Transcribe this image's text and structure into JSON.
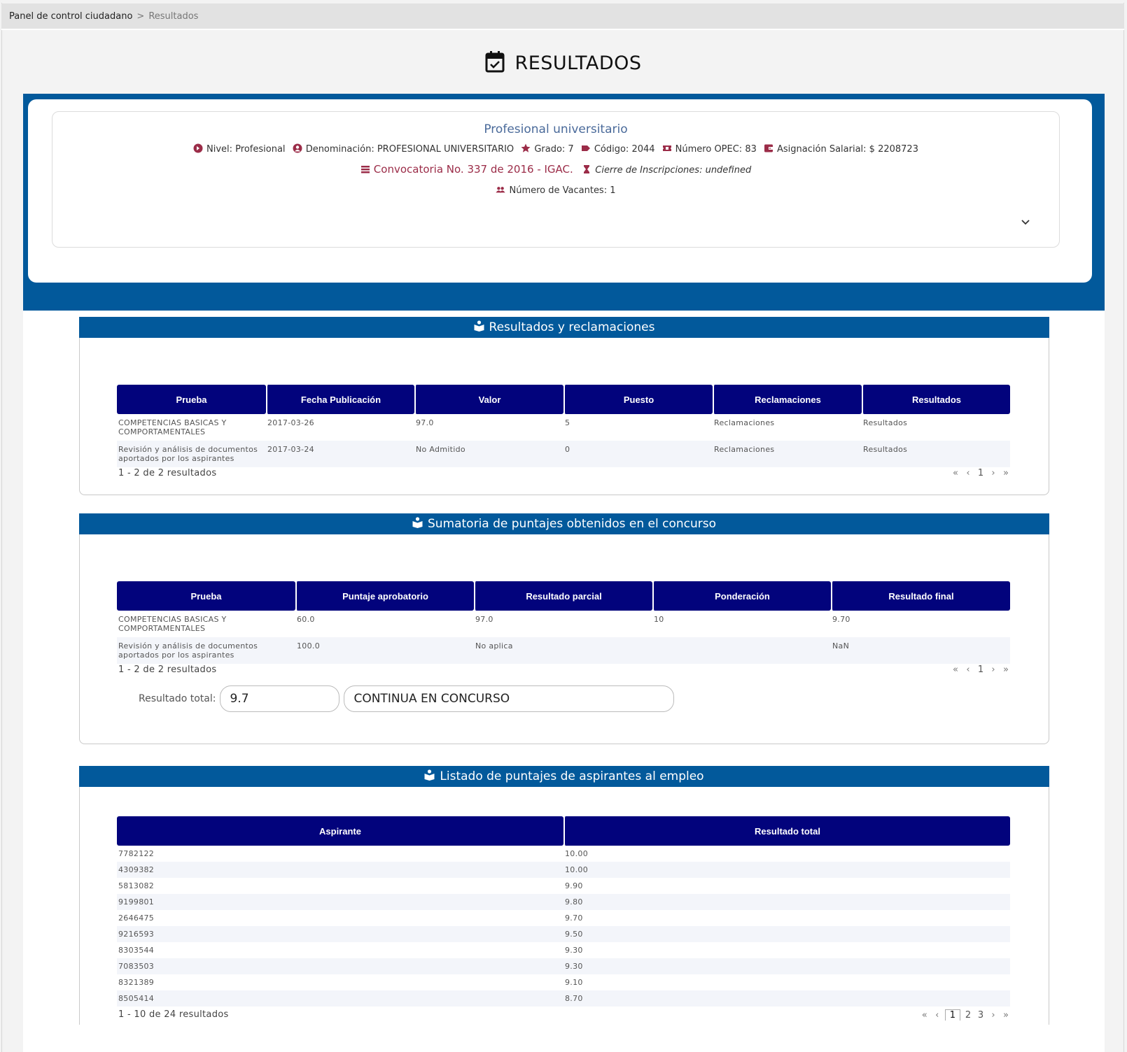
{
  "breadcrumb": {
    "root": "Panel de control ciudadano",
    "separator": ">",
    "current": "Resultados"
  },
  "page_title": "RESULTADOS",
  "job": {
    "title": "Profesional universitario",
    "nivel": "Nivel: Profesional",
    "denominacion": "Denominación: PROFESIONAL UNIVERSITARIO",
    "grado": "Grado: 7",
    "codigo": "Código: 2044",
    "opec": "Número OPEC: 83",
    "salario": "Asignación Salarial: $ 2208723",
    "convocatoria": "Convocatoria No. 337 de 2016 - IGAC.",
    "cierre": "Cierre de Inscripciones: undefined",
    "vacantes": "Número de Vacantes: 1"
  },
  "accent_color": "#9b2c48",
  "header_color": "#02599b",
  "table_header_color": "#02037c",
  "resultados": {
    "title": "Resultados y reclamaciones",
    "columns": [
      "Prueba",
      "Fecha Publicación",
      "Valor",
      "Puesto",
      "Reclamaciones",
      "Resultados"
    ],
    "rows": [
      [
        "COMPETENCIAS BASICAS Y COMPORTAMENTALES",
        "2017-03-26",
        "97.0",
        "5",
        "Reclamaciones",
        "Resultados"
      ],
      [
        "Revisión y análisis de documentos aportados por los aspirantes",
        "2017-03-24",
        "No Admitido",
        "0",
        "Reclamaciones",
        "Resultados"
      ]
    ],
    "count": "1 - 2 de 2 resultados",
    "pager": {
      "first": "«",
      "prev": "‹",
      "pages": [
        "1"
      ],
      "next": "›",
      "last": "»"
    }
  },
  "sumatoria": {
    "title": "Sumatoria de puntajes obtenidos en el concurso",
    "columns": [
      "Prueba",
      "Puntaje aprobatorio",
      "Resultado parcial",
      "Ponderación",
      "Resultado final"
    ],
    "rows": [
      [
        "COMPETENCIAS BASICAS Y COMPORTAMENTALES",
        "60.0",
        "97.0",
        "10",
        "9.70"
      ],
      [
        "Revisión y análisis de documentos aportados por los aspirantes",
        "100.0",
        "No aplica",
        "",
        "NaN"
      ]
    ],
    "count": "1 - 2 de 2 resultados",
    "pager": {
      "first": "«",
      "prev": "‹",
      "pages": [
        "1"
      ],
      "next": "›",
      "last": "»"
    },
    "total_label": "Resultado total:",
    "total_value": "9.7",
    "status_value": "CONTINUA EN CONCURSO"
  },
  "listado": {
    "title": "Listado de puntajes de aspirantes al empleo",
    "columns": [
      "Aspirante",
      "Resultado total"
    ],
    "rows": [
      [
        "7782122",
        "10.00"
      ],
      [
        "4309382",
        "10.00"
      ],
      [
        "5813082",
        "9.90"
      ],
      [
        "9199801",
        "9.80"
      ],
      [
        "2646475",
        "9.70"
      ],
      [
        "9216593",
        "9.50"
      ],
      [
        "8303544",
        "9.30"
      ],
      [
        "7083503",
        "9.30"
      ],
      [
        "8321389",
        "9.10"
      ],
      [
        "8505414",
        "8.70"
      ]
    ],
    "count": "1 - 10 de 24 resultados",
    "pager": {
      "first": "«",
      "prev": "‹",
      "pages": [
        "1",
        "2",
        "3"
      ],
      "next": "›",
      "last": "»"
    }
  }
}
